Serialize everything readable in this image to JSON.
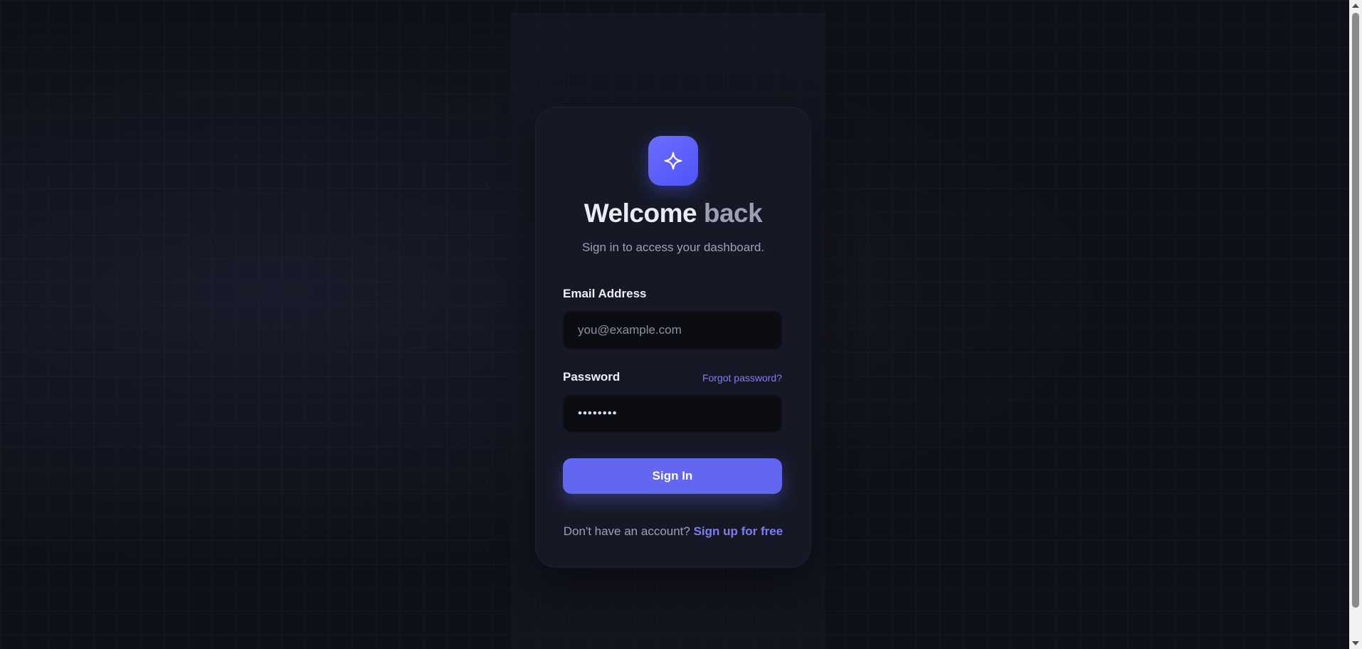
{
  "login": {
    "title_part1": "Welcome",
    "title_part2": "back",
    "subtitle": "Sign in to access your dashboard.",
    "email_label": "Email Address",
    "email_placeholder": "you@example.com",
    "password_label": "Password",
    "password_value": "••••••••",
    "forgot_link": "Forgot password?",
    "submit_label": "Sign In",
    "footer_text": "Don't have an account?",
    "signup_link": "Sign up for free"
  },
  "icons": {
    "logo": "sparkle-icon"
  },
  "colors": {
    "accent": "#6366f1",
    "link": "#7f7cf3",
    "background": "#0f1119",
    "card": "#161925",
    "input_bg": "#0b0d13"
  }
}
